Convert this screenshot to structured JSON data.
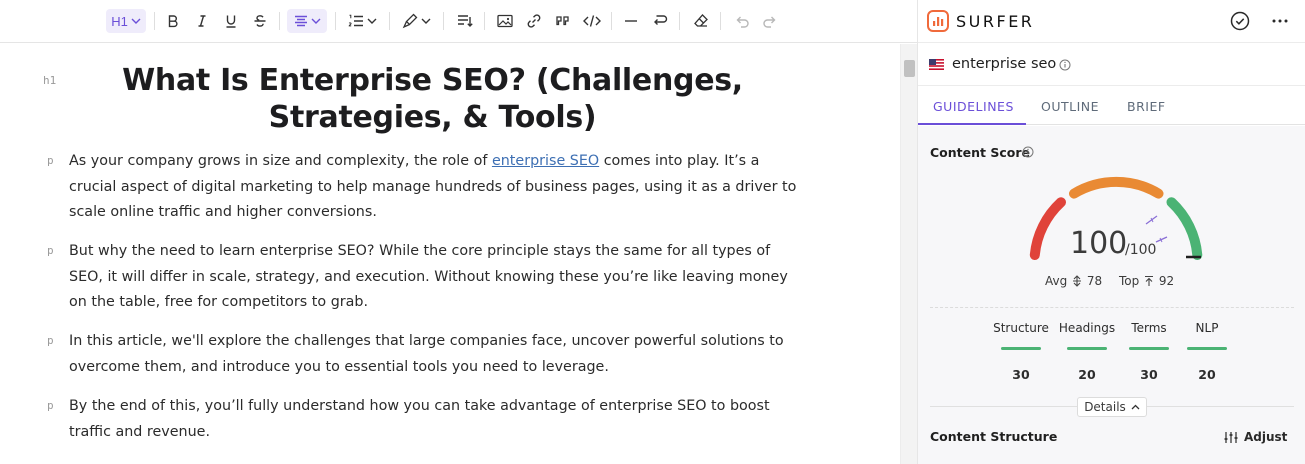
{
  "toolbar": {
    "heading_label": "H1",
    "items": [
      "heading-dropdown",
      "bold",
      "italic",
      "underline",
      "strikethrough",
      "align",
      "list",
      "highlight",
      "line-height",
      "image",
      "link",
      "quote",
      "code",
      "horizontal-rule",
      "hard-break",
      "clear-format",
      "undo",
      "redo"
    ]
  },
  "editor": {
    "h1_tag": "h1",
    "title": "What Is Enterprise SEO? (Challenges, Strategies, & Tools)",
    "paragraph_tag": "p",
    "paragraphs": [
      {
        "before": "As your company grows in size and complexity, the role of ",
        "link": "enterprise SEO",
        "after": " comes into play. It’s a crucial aspect of digital marketing to help manage hundreds of business pages, using it as a driver to scale online traffic and higher conversions."
      },
      {
        "text": "But why the need to learn enterprise SEO? While the core principle stays the same for all types of SEO, it will differ in scale, strategy, and execution. Without knowing these you’re like leaving money on the table, free for competitors to grab."
      },
      {
        "text": "In this article, we'll explore the challenges that large companies face, uncover powerful solutions to overcome them, and introduce you to essential tools you need to leverage."
      },
      {
        "text": "By the end of this, you’ll fully understand how you can take advantage of enterprise SEO to boost traffic and revenue."
      }
    ]
  },
  "panel": {
    "brand": "SURFER",
    "keyword": "enterprise seo",
    "tabs": [
      {
        "label": "GUIDELINES",
        "active": true
      },
      {
        "label": "OUTLINE",
        "active": false
      },
      {
        "label": "BRIEF",
        "active": false
      }
    ],
    "content_score": {
      "title": "Content Score",
      "value": "100",
      "max": "/100",
      "score_fraction": 1.0,
      "avg_label": "Avg",
      "avg_value": "78",
      "top_label": "Top",
      "top_value": "92",
      "colors": {
        "low": "#e0433a",
        "mid": "#e98a34",
        "high": "#4bb374",
        "marker": "#8a6fd6"
      }
    },
    "metrics": [
      {
        "label": "Structure",
        "value": "30"
      },
      {
        "label": "Headings",
        "value": "20"
      },
      {
        "label": "Terms",
        "value": "30"
      },
      {
        "label": "NLP",
        "value": "20"
      }
    ],
    "details_label": "Details",
    "content_structure_title": "Content Structure",
    "adjust_label": "Adjust"
  }
}
